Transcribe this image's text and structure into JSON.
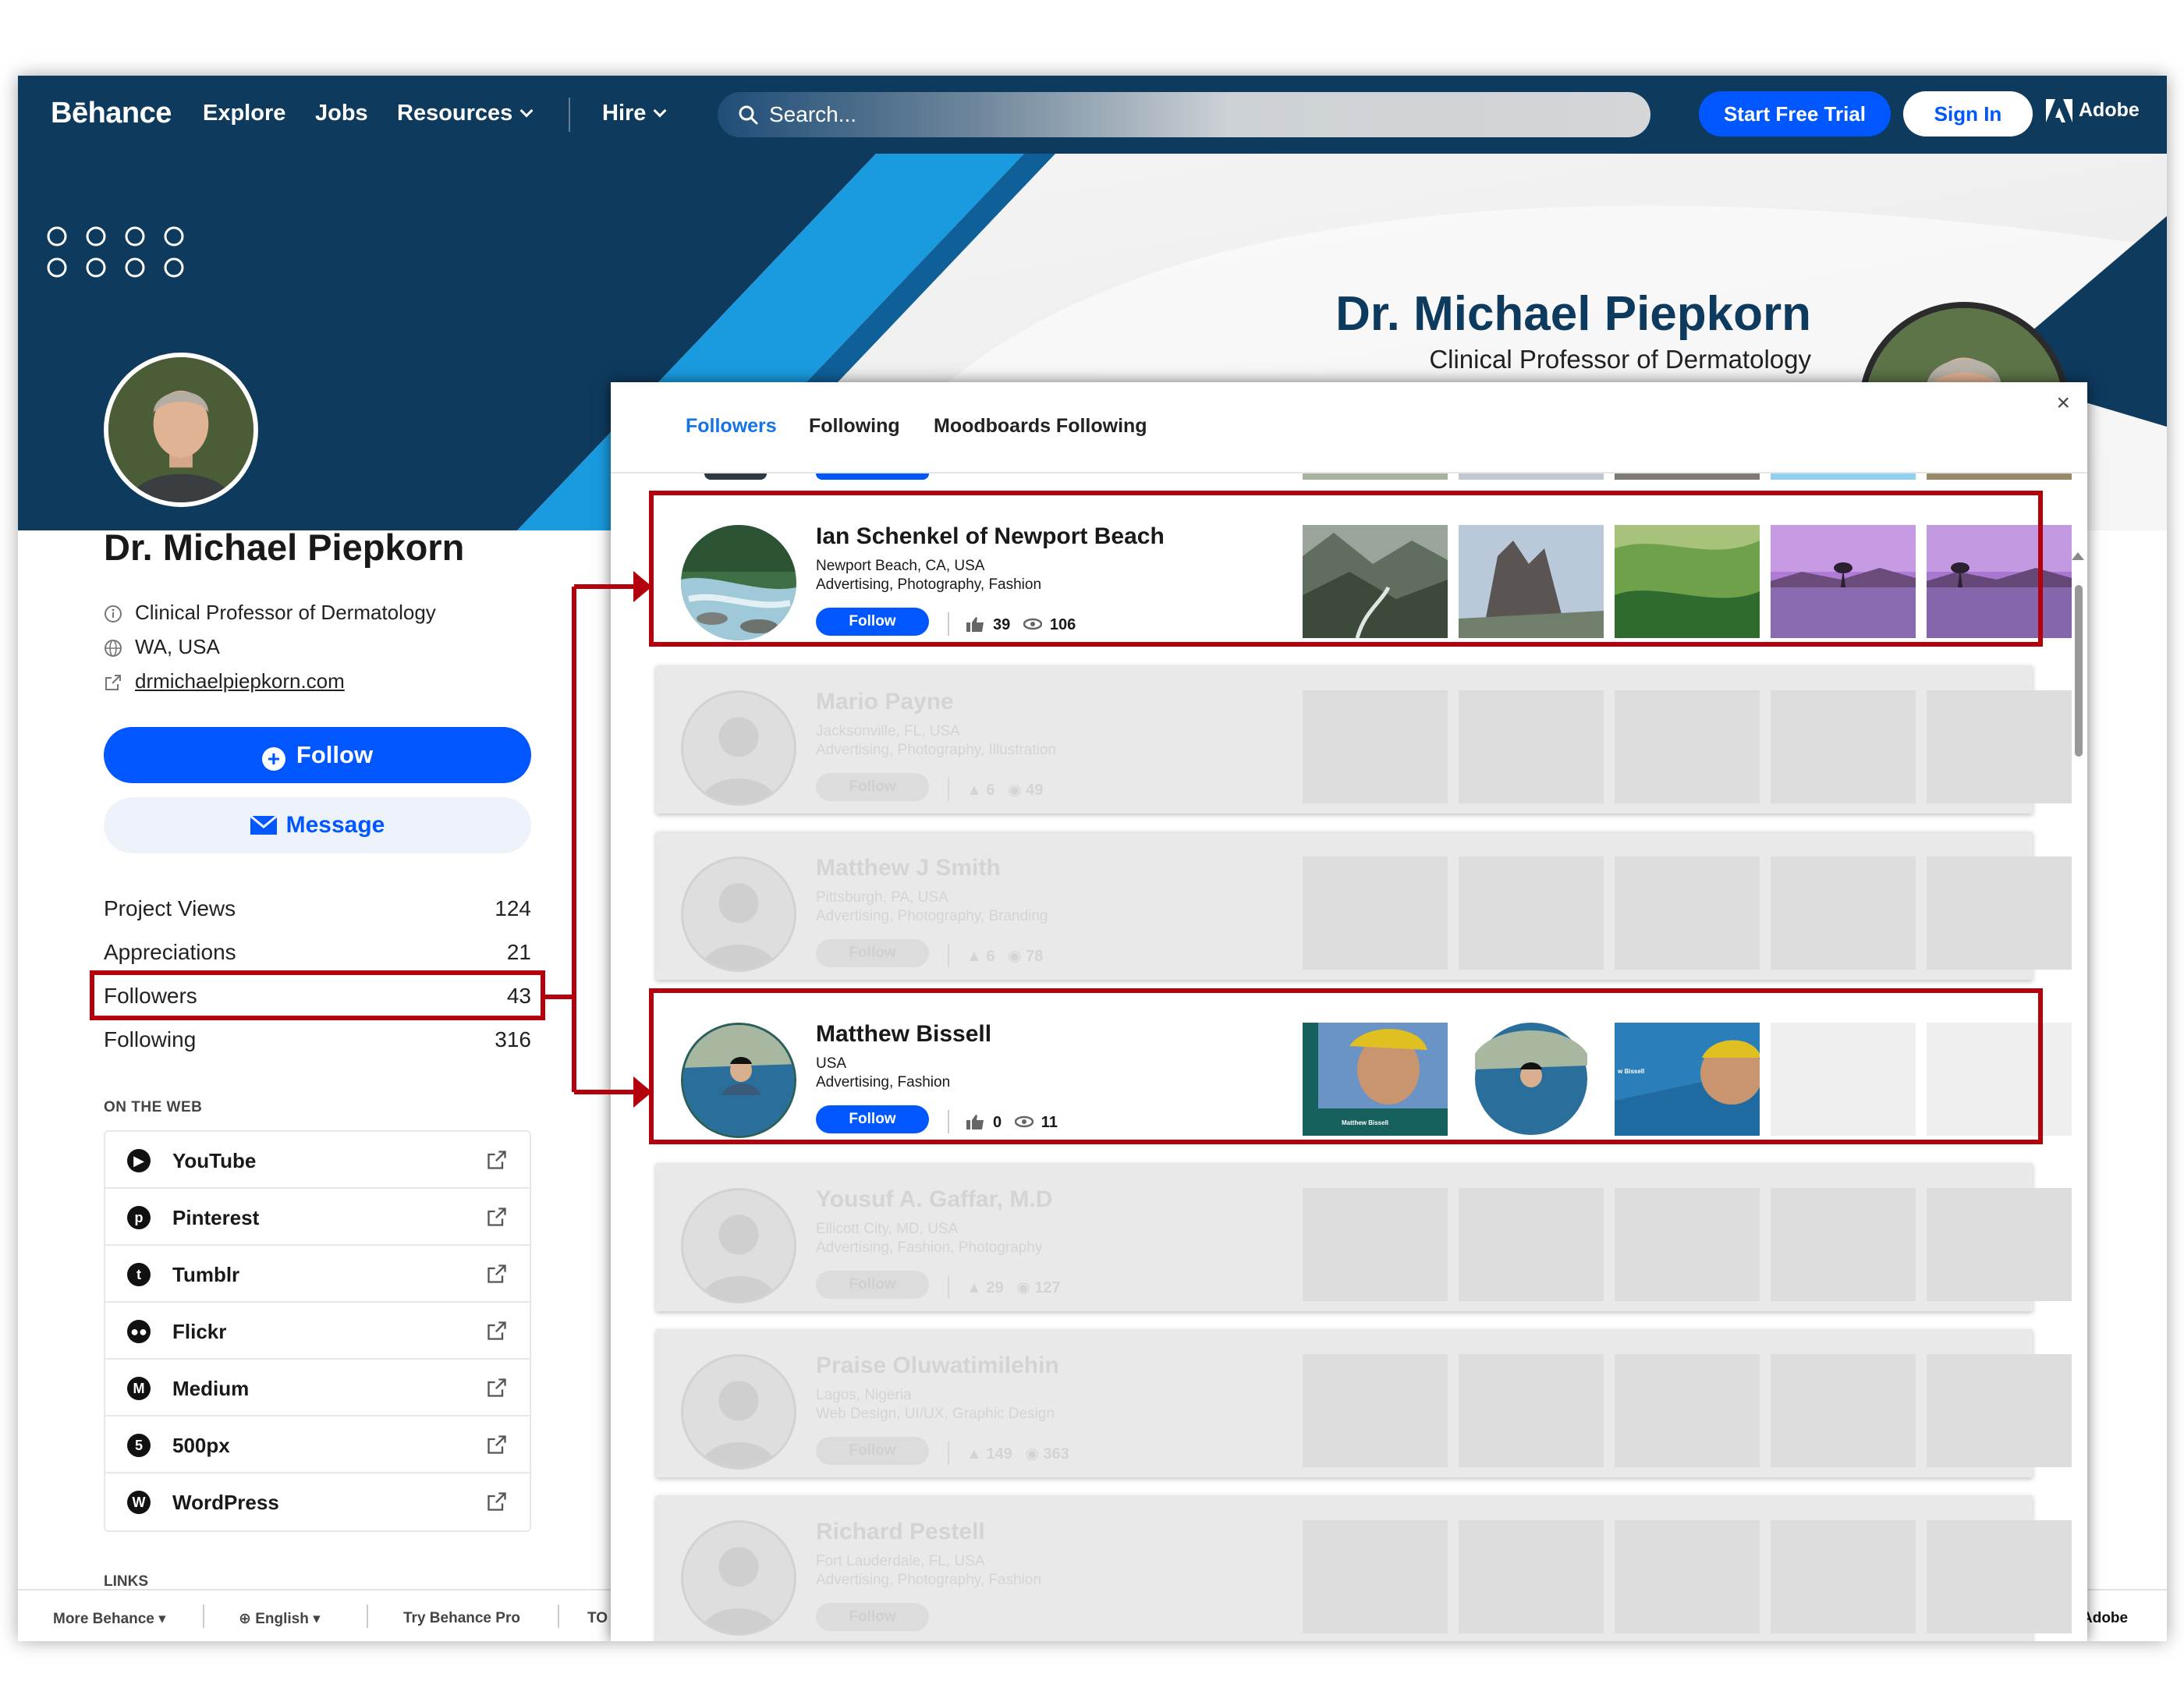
{
  "topnav": {
    "logo": "Bēhance",
    "explore": "Explore",
    "jobs": "Jobs",
    "resources": "Resources",
    "hire": "Hire",
    "search_placeholder": "Search...",
    "start_trial": "Start Free Trial",
    "sign_in": "Sign In",
    "adobe": "Adobe"
  },
  "banner": {
    "name": "Dr. Michael Piepkorn",
    "title": "Clinical Professor of Dermatology"
  },
  "profile": {
    "name": "Dr. Michael Piepkorn",
    "occupation": "Clinical Professor of Dermatology",
    "location": "WA, USA",
    "website": "drmichaelpiepkorn.com",
    "follow_label": "Follow",
    "message_label": "Message",
    "stats": [
      {
        "label": "Project Views",
        "value": "124"
      },
      {
        "label": "Appreciations",
        "value": "21"
      },
      {
        "label": "Followers",
        "value": "43"
      },
      {
        "label": "Following",
        "value": "316"
      }
    ],
    "on_the_web_title": "ON THE WEB",
    "web_links": [
      {
        "label": "YouTube",
        "icon": "youtube-icon"
      },
      {
        "label": "Pinterest",
        "icon": "pinterest-icon"
      },
      {
        "label": "Tumblr",
        "icon": "tumblr-icon"
      },
      {
        "label": "Flickr",
        "icon": "flickr-icon"
      },
      {
        "label": "Medium",
        "icon": "medium-icon"
      },
      {
        "label": "500px",
        "icon": "500px-icon"
      },
      {
        "label": "WordPress",
        "icon": "wordpress-icon"
      }
    ],
    "links_title": "LINKS"
  },
  "footer": {
    "more_behance": "More Behance",
    "language": "English",
    "try_pro": "Try Behance Pro",
    "tou": "TO",
    "adobe": "Adobe"
  },
  "modal": {
    "tabs": [
      "Followers",
      "Following",
      "Moodboards Following"
    ],
    "active_tab": "Followers",
    "close": "×",
    "followers": [
      {
        "name": "Ian Schenkel of Newport Beach",
        "location": "Newport Beach, CA, USA",
        "fields": "Advertising, Photography, Fashion",
        "follow": "Follow",
        "appreciations": "39",
        "views": "106",
        "highlighted": true
      },
      {
        "name": "Mario Payne",
        "location": "Jacksonville, FL, USA",
        "fields": "Advertising, Photography, Illustration",
        "follow": "Follow",
        "appreciations": "6",
        "views": "49",
        "highlighted": false
      },
      {
        "name": "Matthew J Smith",
        "location": "Pittsburgh, PA, USA",
        "fields": "Advertising, Photography, Branding",
        "follow": "Follow",
        "appreciations": "6",
        "views": "78",
        "highlighted": false
      },
      {
        "name": "Matthew Bissell",
        "location": "USA",
        "fields": "Advertising, Fashion",
        "follow": "Follow",
        "appreciations": "0",
        "views": "11",
        "highlighted": true
      },
      {
        "name": "Yousuf A. Gaffar, M.D",
        "location": "Ellicott City, MD, USA",
        "fields": "Advertising, Fashion, Photography",
        "follow": "Follow",
        "appreciations": "29",
        "views": "127",
        "highlighted": false
      },
      {
        "name": "Praise Oluwatimilehin",
        "location": "Lagos, Nigeria",
        "fields": "Web Design, UI/UX, Graphic Design",
        "follow": "Follow",
        "appreciations": "149",
        "views": "363",
        "highlighted": false
      },
      {
        "name": "Richard Pestell",
        "location": "Fort Lauderdale, FL, USA",
        "fields": "Advertising, Photography, Fashion",
        "follow": "Follow",
        "appreciations": "",
        "views": "",
        "highlighted": false
      }
    ],
    "thumb_captions": {
      "bissell_1": "Matthew Bissell",
      "bissell_3": "w Bissell"
    }
  },
  "colors": {
    "behance_blue": "#0057ff",
    "navy": "#0e3a5e",
    "highlight_red": "#b3000c",
    "tab_active": "#1473e6"
  }
}
